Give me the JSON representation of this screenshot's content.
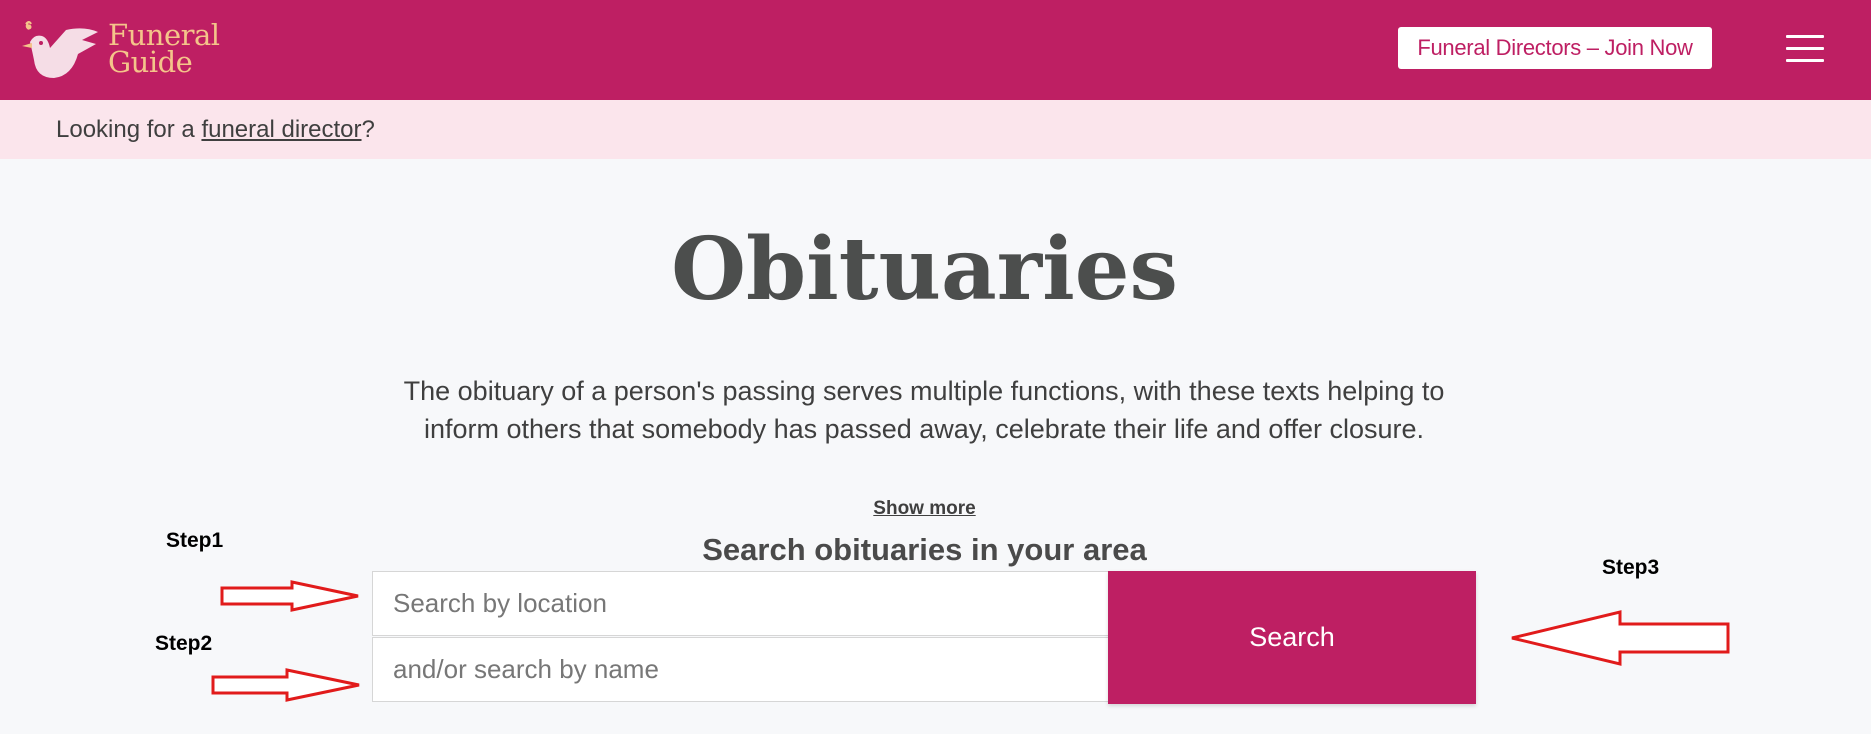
{
  "header": {
    "logo_line1": "Funeral",
    "logo_line2": "Guide",
    "join_label": "Funeral Directors – Join Now",
    "menu_icon": "hamburger-menu-icon",
    "brand_color": "#be1f63",
    "logo_text_color": "#f4c48a"
  },
  "banner": {
    "prefix": "Looking for a ",
    "link": "funeral director",
    "suffix": "?",
    "background": "#fbe5ec"
  },
  "main": {
    "title": "Obituaries",
    "intro": "The obituary of a person's passing serves multiple functions, with these texts helping to inform others that somebody has passed away, celebrate their life and offer closure.",
    "show_more": "Show more",
    "search_heading": "Search obituaries in your area",
    "location_placeholder": "Search by location",
    "name_placeholder": "and/or search by name",
    "search_label": "Search"
  },
  "annotations": {
    "step1": "Step1",
    "step2": "Step2",
    "step3": "Step3",
    "arrow_color": "#e11b1b"
  }
}
